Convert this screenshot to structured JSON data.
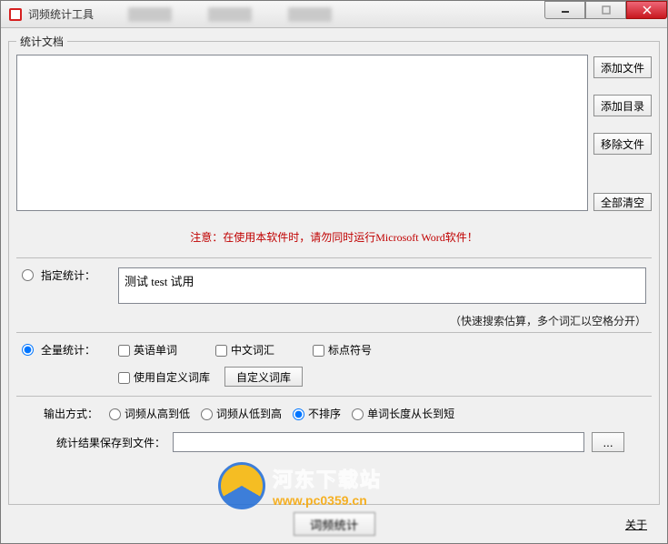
{
  "window": {
    "title": "词频统计工具"
  },
  "fieldset": {
    "legend": "统计文档"
  },
  "doc_buttons": {
    "add_file": "添加文件",
    "add_dir": "添加目录",
    "remove_file": "移除文件",
    "clear_all": "全部清空"
  },
  "warning": "注意：在使用本软件时，请勿同时运行Microsoft Word软件！",
  "mode": {
    "specified_label": "指定统计：",
    "specified_value": "测试 test 试用",
    "specified_hint": "（快速搜索估算，多个词汇以空格分开）",
    "full_label": "全量统计："
  },
  "full_checks": {
    "english": "英语单词",
    "chinese": "中文词汇",
    "punct": "标点符号",
    "use_custom": "使用自定义词库",
    "custom_btn": "自定义词库"
  },
  "output": {
    "label": "输出方式：",
    "opt_high_low": "词频从高到低",
    "opt_low_high": "词频从低到高",
    "opt_no_sort": "不排序",
    "opt_len_long_short": "单词长度从长到短"
  },
  "save": {
    "label": "统计结果保存到文件：",
    "value": "",
    "browse": "..."
  },
  "footer": {
    "run": "词频统计",
    "about": "关于"
  },
  "watermark": {
    "title": "河东下载站",
    "url": "www.pc0359.cn"
  }
}
